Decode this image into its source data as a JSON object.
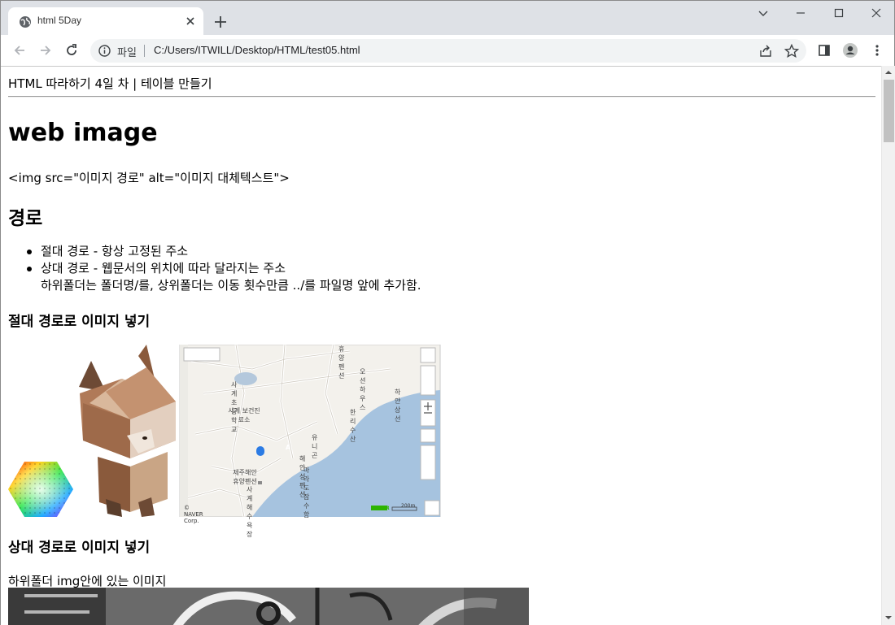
{
  "browser": {
    "tab_title": "html 5Day",
    "omnibox": {
      "scheme_label": "파일",
      "url": "C:/Users/ITWILL/Desktop/HTML/test05.html"
    },
    "icons": [
      "globe-icon",
      "close-icon",
      "plus-icon",
      "chevron-down-icon",
      "minimize-icon",
      "maximize-icon",
      "back-icon",
      "forward-icon",
      "reload-icon",
      "info-icon",
      "share-icon",
      "star-icon",
      "side-panel-icon",
      "profile-icon",
      "kebab-menu-icon"
    ]
  },
  "page": {
    "header_line": "HTML 따라하기 4일 차 | 테이블 만들기",
    "title": "web image",
    "img_syntax": "<img src=\"이미지 경로\" alt=\"이미지 대체텍스트\">",
    "section_path": "경로",
    "list": [
      "절대 경로 - 항상 고정된 주소",
      "상대 경로 - 웹문서의 위치에 따라 달라지는 주소"
    ],
    "list_continuation": "하위폴더는 폴더명/를, 상위폴더는 이동 횟수만큼 ../를 파일명 앞에 추가함.",
    "section_absolute": "절대 경로로 이미지 넣기",
    "section_relative": "상대 경로로 이미지 넣기",
    "relative_note": "하위폴더 img안에 있는 이미지",
    "map": {
      "labels": [
        "휴양펜션",
        "오션하우스",
        "사계초등학교",
        "사계 보건진료소",
        "한리수산",
        "하얀상선",
        "유니곤",
        "해안성펜션",
        "마라도잠수함",
        "제주해안 휴양펜션",
        "사계해수욕장"
      ],
      "copyright": "© NAVER Corp.",
      "brand": "NAVER",
      "scale": "200m",
      "marker": "A"
    }
  }
}
